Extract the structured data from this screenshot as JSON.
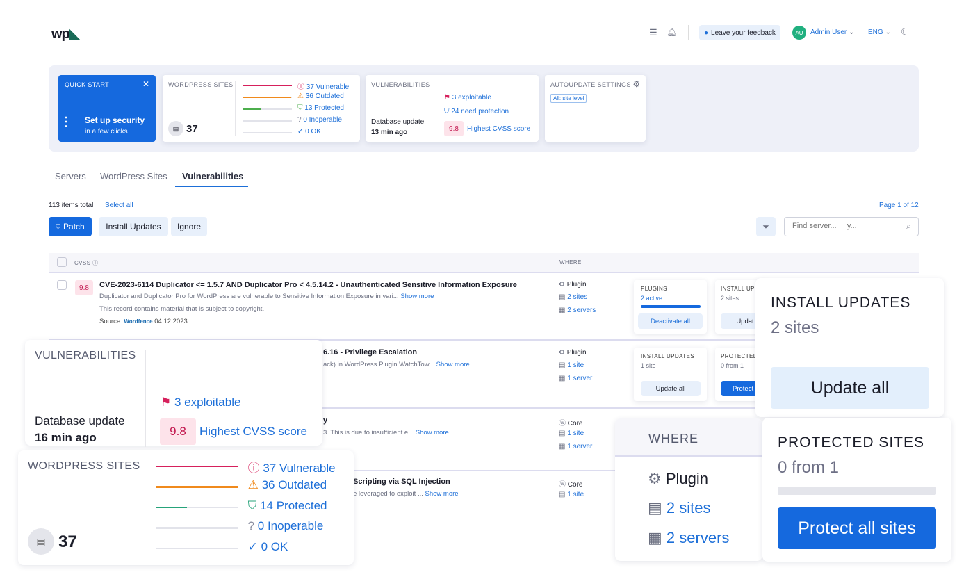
{
  "header": {
    "logo": "wp",
    "feedback": "Leave your feedback",
    "avatar": "AU",
    "user": "Admin User",
    "lang": "ENG"
  },
  "quick_start": {
    "label": "QUICK START",
    "title": "Set up security",
    "subtitle": "in a few clicks"
  },
  "wp_sites": {
    "label": "WORDPRESS SITES",
    "count": "37",
    "stats": [
      {
        "text": "37 Vulnerable",
        "color": "#d6205c",
        "fill": 1
      },
      {
        "text": "36 Outdated",
        "color": "#f08a1c",
        "fill": 0.97
      },
      {
        "text": "13 Protected",
        "color": "#4cae4c",
        "fill": 0.35
      },
      {
        "text": "0 Inoperable",
        "color": "#8a8ea0",
        "fill": 0
      },
      {
        "text": "0 OK",
        "color": "#1d6fd8",
        "fill": 0
      }
    ]
  },
  "vulns": {
    "label": "VULNERABILITIES",
    "db_label": "Database update",
    "db_time": "13 min ago",
    "exploitable": "3 exploitable",
    "need_protection": "24 need protection",
    "score": "9.8",
    "score_label": "Highest CVSS score"
  },
  "autoupdate": {
    "label": "AUTOUPDATE SETTINGS",
    "badge": "All: site level"
  },
  "tabs": [
    "Servers",
    "WordPress Sites",
    "Vulnerabilities"
  ],
  "toolbar": {
    "total": "113 items total",
    "select_all": "Select all",
    "page": "Page 1 of 12",
    "patch": "Patch",
    "install": "Install Updates",
    "ignore": "Ignore",
    "search_placeholder": "Find server...     y..."
  },
  "table": {
    "col_cvss": "CVSS",
    "col_where": "WHERE"
  },
  "rows": [
    {
      "score": "9.8",
      "title": "CVE-2023-6114 Duplicator <= 1.5.7 AND Duplicator Pro < 4.5.14.2 - Unauthenticated Sensitive Information Exposure",
      "desc": "Duplicator and Duplicator Pro for WordPress are vulnerable to Sensitive Information Exposure in vari...",
      "more": "Show more",
      "copy": "This record contains material that is subject to copyright.",
      "source": "Source:",
      "source_name": "Wordfence",
      "date": "04.12.2023",
      "type": "Plugin",
      "sites": "2 sites",
      "servers": "2 servers"
    },
    {
      "title": "6.16 - Privilege Escalation",
      "desc": "ack) in WordPress Plugin WatchTow...",
      "more": "Show more",
      "type": "Plugin",
      "sites": "1 site",
      "servers": "1 server"
    },
    {
      "title": "y",
      "desc": "3. This is due to insufficient e...",
      "more": "Show more",
      "type": "Core",
      "sites": "1 site",
      "servers": "1 server"
    },
    {
      "title": "Scripting via SQL Injection",
      "desc": "e leveraged to exploit ...",
      "more": "Show more",
      "type": "Core",
      "sites": "1 site"
    }
  ],
  "row_actions": {
    "plugins": {
      "label": "PLUGINS",
      "sub": "2 active",
      "btn": "Deactivate all"
    },
    "install1": {
      "label": "INSTALL UP",
      "sub": "2 sites",
      "btn": "Updat"
    },
    "install2": {
      "label": "INSTALL UPDATES",
      "sub": "1 site",
      "btn": "Update all"
    },
    "protect2": {
      "label": "PROTECTED",
      "sub": "0 from 1",
      "btn": "Protect a"
    }
  },
  "overlays": {
    "vulns": {
      "label": "VULNERABILITIES",
      "db_label": "Database update",
      "db_time": "16 min ago",
      "exploitable": "3 exploitable",
      "score": "9.8",
      "score_label": "Highest CVSS score"
    },
    "wp_sites": {
      "label": "WORDPRESS SITES",
      "count": "37",
      "stats": [
        {
          "text": "37 Vulnerable",
          "color": "#d6205c",
          "fill": 1
        },
        {
          "text": "36 Outdated",
          "color": "#f08a1c",
          "fill": 1
        },
        {
          "text": "14 Protected",
          "color": "#26a37a",
          "fill": 0.38
        },
        {
          "text": "0 Inoperable",
          "color": "#8a8ea0",
          "fill": 0
        },
        {
          "text": "0 OK",
          "color": "#1d6fd8",
          "fill": 0
        }
      ]
    },
    "install": {
      "label": "INSTALL UPDATES",
      "sub": "2 sites",
      "btn": "Update all"
    },
    "where": {
      "label": "WHERE",
      "type": "Plugin",
      "sites": "2 sites",
      "servers": "2 servers"
    },
    "protected": {
      "label": "PROTECTED SITES",
      "sub": "0 from 1",
      "btn": "Protect all sites",
      "fill": 0
    }
  }
}
